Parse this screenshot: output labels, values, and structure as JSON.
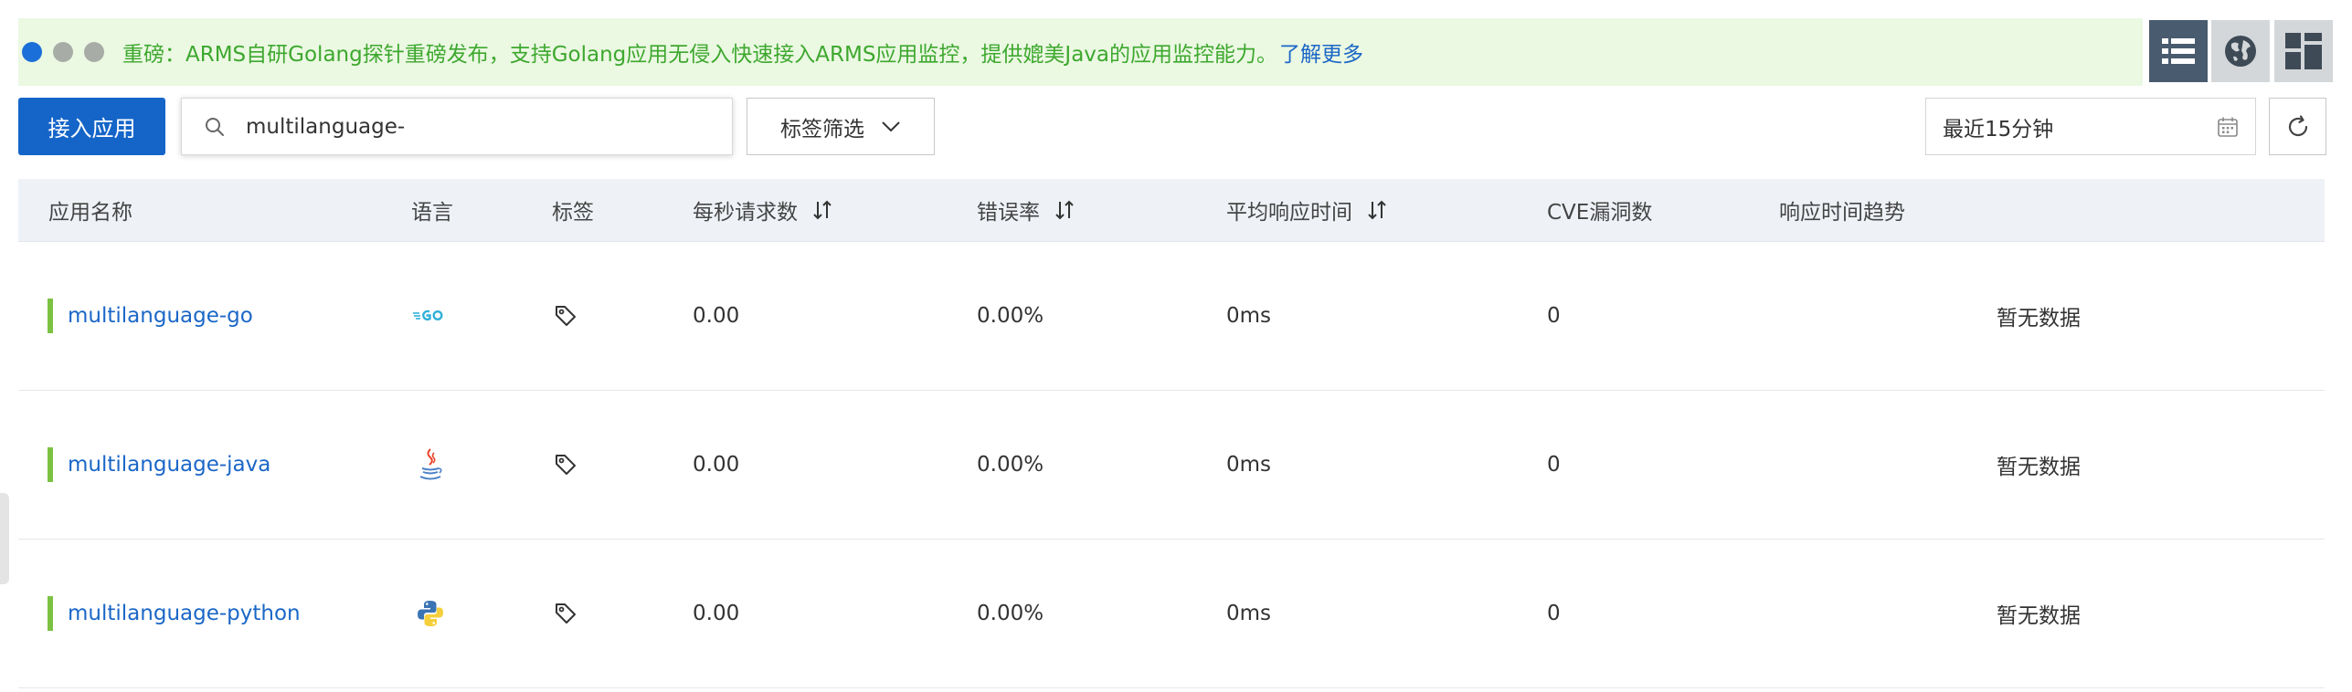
{
  "banner": {
    "text": "重磅：ARMS自研Golang探针重磅发布，支持Golang应用无侵入快速接入ARMS应用监控，提供媲美Java的应用监控能力。",
    "link": "了解更多"
  },
  "toolbar": {
    "connect_label": "接入应用",
    "search_value": "multilanguage-",
    "tag_filter_label": "标签筛选",
    "time_range": "最近15分钟"
  },
  "table": {
    "headers": {
      "name": "应用名称",
      "language": "语言",
      "tags": "标签",
      "rps": "每秒请求数",
      "error_rate": "错误率",
      "avg_rt": "平均响应时间",
      "cve": "CVE漏洞数",
      "trend": "响应时间趋势"
    },
    "rows": [
      {
        "name": "multilanguage-go",
        "language": "go",
        "rps": "0.00",
        "error_rate": "0.00%",
        "avg_rt": "0ms",
        "cve": "0",
        "trend": "暂无数据"
      },
      {
        "name": "multilanguage-java",
        "language": "java",
        "rps": "0.00",
        "error_rate": "0.00%",
        "avg_rt": "0ms",
        "cve": "0",
        "trend": "暂无数据"
      },
      {
        "name": "multilanguage-python",
        "language": "python",
        "rps": "0.00",
        "error_rate": "0.00%",
        "avg_rt": "0ms",
        "cve": "0",
        "trend": "暂无数据"
      }
    ]
  },
  "colors": {
    "primary": "#1565c9",
    "banner_bg": "#ebf8e2",
    "banner_text": "#3da82e",
    "link": "#1b67c7",
    "status_bar": "#7cc242",
    "header_bg": "#eef2f7"
  },
  "icons": {
    "view_list": "list-view-icon",
    "view_globe": "globe-view-icon",
    "view_grid": "grid-view-icon",
    "search": "search-icon",
    "calendar": "calendar-icon",
    "refresh": "refresh-icon",
    "tag": "tag-icon",
    "sort": "sort-icon"
  }
}
